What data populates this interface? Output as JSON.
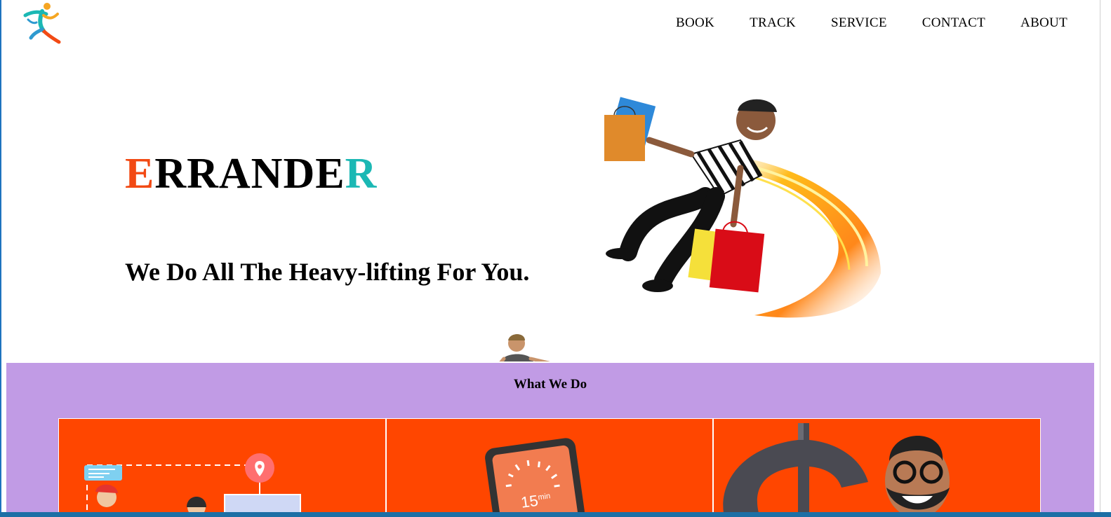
{
  "header": {
    "logo_icon": "running-person-logo",
    "nav": [
      {
        "label": "BOOK"
      },
      {
        "label": "TRACK"
      },
      {
        "label": "SERVICE"
      },
      {
        "label": "CONTACT"
      },
      {
        "label": "ABOUT"
      }
    ]
  },
  "hero": {
    "brand_first": "E",
    "brand_middle": "RRANDE",
    "brand_last": "R",
    "tagline": "We Do All The Heavy-lifting For You.",
    "illustration": "flying-courier-with-shopping-bags"
  },
  "what_we_do": {
    "title": "What We Do",
    "cards": [
      {
        "illustration": "delivery-tracking-map"
      },
      {
        "illustration": "phone-15-min-timer",
        "timer_text": "15",
        "timer_unit": "min"
      },
      {
        "illustration": "dollar-sign-with-man"
      }
    ]
  },
  "colors": {
    "accent_orange": "#f24a14",
    "accent_teal": "#1bb8b4",
    "section_purple": "#c19be5",
    "card_orange": "#ff4600"
  }
}
